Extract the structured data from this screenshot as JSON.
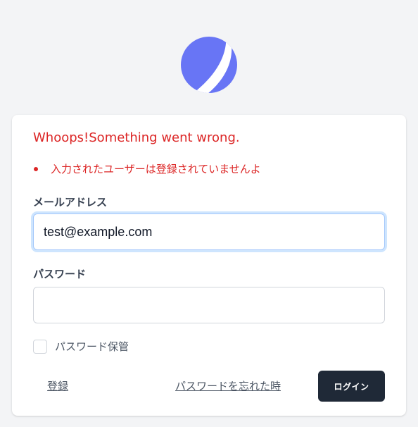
{
  "error": {
    "title": "Whoops!Something went wrong.",
    "messages": [
      "入力されたユーザーは登録されていませんよ"
    ]
  },
  "form": {
    "email_label": "メールアドレス",
    "email_value": "test@example.com",
    "password_label": "パスワード",
    "password_value": "",
    "remember_label": "パスワード保管",
    "register_link": "登録",
    "forgot_link": "パスワードを忘れた時",
    "login_button": "ログイン"
  },
  "colors": {
    "brand": "#6875f5",
    "error": "#dc2626",
    "button": "#1f2937",
    "background": "#f3f4f6"
  }
}
